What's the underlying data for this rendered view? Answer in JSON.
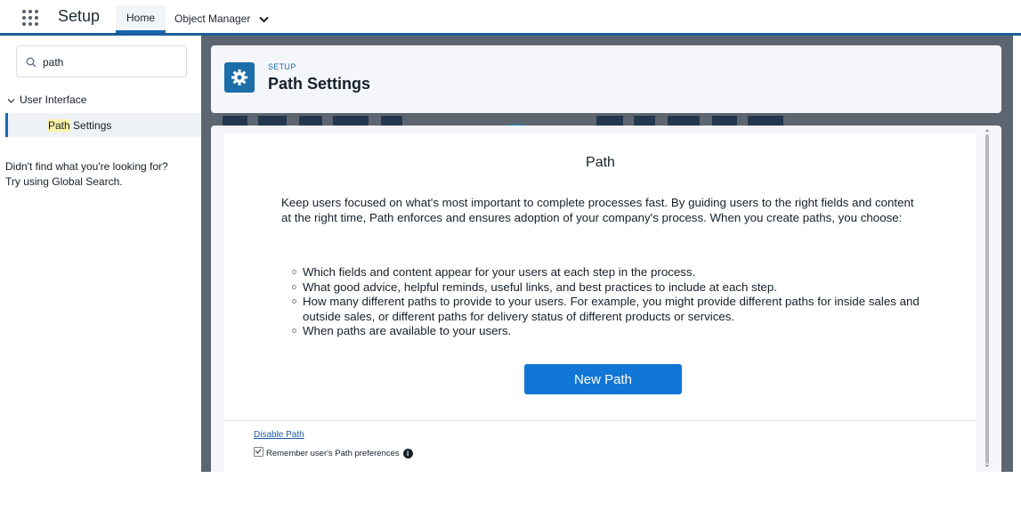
{
  "header": {
    "app_name": "Setup",
    "tabs": [
      {
        "label": "Home",
        "active": true
      },
      {
        "label": "Object Manager",
        "active": false
      }
    ]
  },
  "sidebar": {
    "search": {
      "value": "path",
      "placeholder": "Quick Find"
    },
    "tree": {
      "parent_label": "User Interface",
      "child_label_highlight": "Path",
      "child_label_rest": " Settings"
    },
    "help_line1": "Didn't find what you're looking for?",
    "help_line2": "Try using Global Search."
  },
  "page_header": {
    "eyebrow": "SETUP",
    "title": "Path Settings",
    "icon": "gear-icon"
  },
  "content": {
    "title": "Path",
    "intro": "Keep users focused on what's most important to complete processes fast. By guiding users to the right fields and content at the right time, Path enforces and ensures adoption of your company's process. When you create paths, you choose:",
    "bullets": [
      "Which fields and content appear for your users at each step in the process.",
      "What good advice, helpful reminds, useful links, and best practices to include at each step.",
      "How many different paths to provide to your users. For example, you might provide different paths for inside sales and outside sales, or different paths for delivery status of different products or services.",
      "When paths are available to your users."
    ],
    "new_path_button": "New Path",
    "disable_link": "Disable Path",
    "remember_label": "Remember user's Path preferences",
    "remember_checked": true
  },
  "colors": {
    "brand_blue": "#1668b0",
    "button_blue": "#1176d5",
    "background_gray": "#5d6670"
  }
}
